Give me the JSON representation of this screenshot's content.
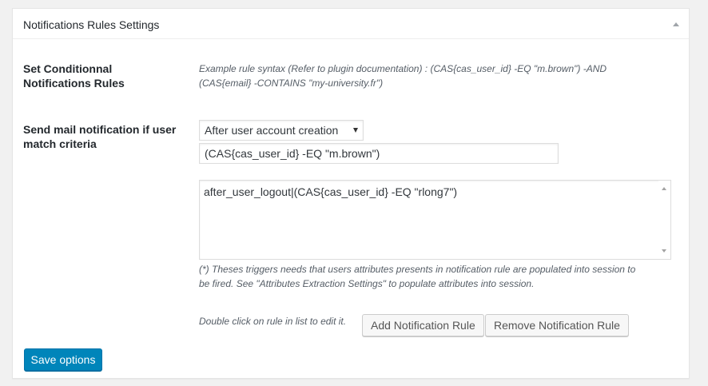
{
  "panel": {
    "title": "Notifications Rules Settings"
  },
  "rules_section": {
    "label_line1": "Set Conditionnal",
    "label_line2": "Notifications Rules",
    "hint_line1": "Example rule syntax (Refer to plugin documentation) : (CAS{cas_user_id} -EQ \"m.brown\") -AND",
    "hint_line2": "(CAS{email} -CONTAINS \"my-university.fr\")"
  },
  "mail_section": {
    "label_line1": "Send mail notification if user",
    "label_line2": "match criteria",
    "trigger_select_value": "After user account creation",
    "rule_input_value": "(CAS{cas_user_id} -EQ \"m.brown\")",
    "rules_list": [
      "after_user_logout|(CAS{cas_user_id} -EQ \"rlong7\")"
    ],
    "note_line1": "(*) Theses triggers needs that users attributes presents in notification rule are populated into session to",
    "note_line2": "be fired. See \"Attributes Extraction Settings\" to populate attributes into session.",
    "edit_hint": "Double click on rule in list to edit it.",
    "add_button": "Add Notification Rule",
    "remove_button": "Remove Notification Rule"
  },
  "footer": {
    "save_button": "Save options"
  },
  "colors": {
    "primary_button": "#0085ba",
    "background": "#f1f1f1"
  }
}
